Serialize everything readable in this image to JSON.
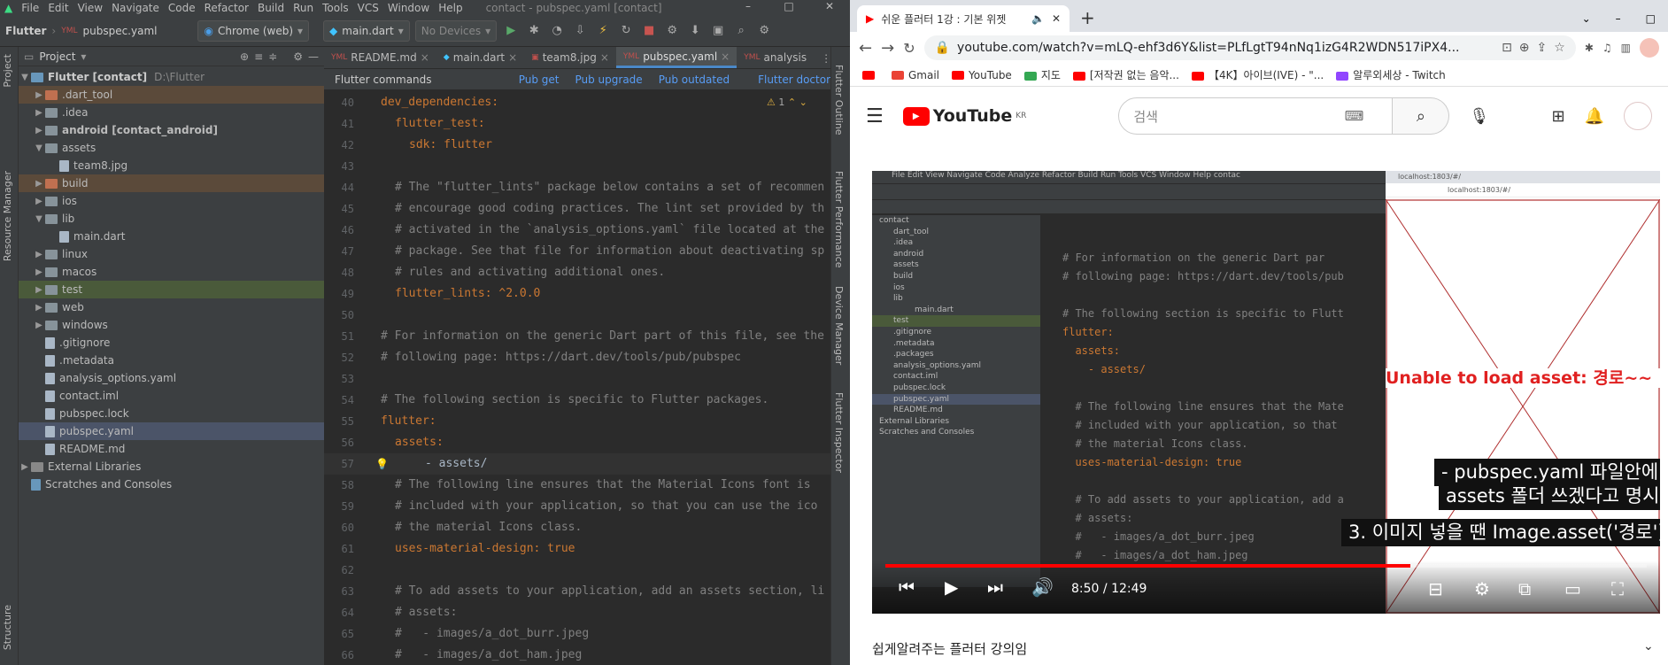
{
  "ide": {
    "menu": [
      "File",
      "Edit",
      "View",
      "Navigate",
      "Code",
      "Refactor",
      "Build",
      "Run",
      "Tools",
      "VCS",
      "Window",
      "Help"
    ],
    "window_title": "contact - pubspec.yaml [contact]",
    "breadcrumb_project": "Flutter",
    "breadcrumb_file": "pubspec.yaml",
    "device_selector": "Chrome (web)",
    "run_config": "main.dart",
    "no_devices": "No Devices",
    "project_label": "Project",
    "tree_root_name": "Flutter [contact]",
    "tree_root_path": "D:\\Flutter",
    "tree": [
      {
        "name": ".dart_tool",
        "type": "folder",
        "depth": 1,
        "arrow": "right"
      },
      {
        "name": ".idea",
        "type": "folder",
        "depth": 1,
        "arrow": "right"
      },
      {
        "name": "android [contact_android]",
        "type": "folder",
        "depth": 1,
        "arrow": "right"
      },
      {
        "name": "assets",
        "type": "folder",
        "depth": 1,
        "arrow": "down"
      },
      {
        "name": "team8.jpg",
        "type": "file",
        "depth": 2,
        "arrow": ""
      },
      {
        "name": "build",
        "type": "folder",
        "depth": 1,
        "arrow": "right"
      },
      {
        "name": "ios",
        "type": "folder",
        "depth": 1,
        "arrow": "right"
      },
      {
        "name": "lib",
        "type": "folder",
        "depth": 1,
        "arrow": "down"
      },
      {
        "name": "main.dart",
        "type": "file",
        "depth": 2,
        "arrow": ""
      },
      {
        "name": "linux",
        "type": "folder",
        "depth": 1,
        "arrow": "right"
      },
      {
        "name": "macos",
        "type": "folder",
        "depth": 1,
        "arrow": "right"
      },
      {
        "name": "test",
        "type": "folder",
        "depth": 1,
        "arrow": "right"
      },
      {
        "name": "web",
        "type": "folder",
        "depth": 1,
        "arrow": "right"
      },
      {
        "name": "windows",
        "type": "folder",
        "depth": 1,
        "arrow": "right"
      },
      {
        "name": ".gitignore",
        "type": "file",
        "depth": 1,
        "arrow": ""
      },
      {
        "name": ".metadata",
        "type": "file",
        "depth": 1,
        "arrow": ""
      },
      {
        "name": "analysis_options.yaml",
        "type": "file",
        "depth": 1,
        "arrow": ""
      },
      {
        "name": "contact.iml",
        "type": "file",
        "depth": 1,
        "arrow": ""
      },
      {
        "name": "pubspec.lock",
        "type": "file",
        "depth": 1,
        "arrow": ""
      },
      {
        "name": "pubspec.yaml",
        "type": "file",
        "depth": 1,
        "arrow": ""
      },
      {
        "name": "README.md",
        "type": "file",
        "depth": 1,
        "arrow": ""
      },
      {
        "name": "External Libraries",
        "type": "lib",
        "depth": 0,
        "arrow": "right"
      },
      {
        "name": "Scratches and Consoles",
        "type": "scratch",
        "depth": 0,
        "arrow": ""
      }
    ],
    "tabs": [
      "README.md",
      "main.dart",
      "team8.jpg",
      "pubspec.yaml",
      "analysis"
    ],
    "active_tab": "pubspec.yaml",
    "flutter_commands": {
      "label": "Flutter commands",
      "pub_get": "Pub get",
      "pub_upgrade": "Pub upgrade",
      "pub_outdated": "Pub outdated",
      "flutter_doctor": "Flutter doctor"
    },
    "warning_count": "1",
    "code_lines": [
      {
        "n": "40",
        "text": "dev_dependencies:",
        "kind": "key",
        "indent": 0
      },
      {
        "n": "41",
        "text": "flutter_test:",
        "kind": "key",
        "indent": 1
      },
      {
        "n": "42",
        "text": "sdk: flutter",
        "kind": "kv",
        "indent": 2
      },
      {
        "n": "43",
        "text": "",
        "kind": "blank",
        "indent": 0
      },
      {
        "n": "44",
        "text": "# The \"flutter_lints\" package below contains a set of recommen",
        "kind": "cmt",
        "indent": 1
      },
      {
        "n": "45",
        "text": "# encourage good coding practices. The lint set provided by th",
        "kind": "cmt",
        "indent": 1
      },
      {
        "n": "46",
        "text": "# activated in the `analysis_options.yaml` file located at the",
        "kind": "cmt",
        "indent": 1
      },
      {
        "n": "47",
        "text": "# package. See that file for information about deactivating sp",
        "kind": "cmt",
        "indent": 1
      },
      {
        "n": "48",
        "text": "# rules and activating additional ones.",
        "kind": "cmt",
        "indent": 1
      },
      {
        "n": "49",
        "text": "flutter_lints: ^2.0.0",
        "kind": "kv",
        "indent": 1
      },
      {
        "n": "50",
        "text": "",
        "kind": "blank",
        "indent": 0
      },
      {
        "n": "51",
        "text": "# For information on the generic Dart part of this file, see the",
        "kind": "cmt",
        "indent": 0
      },
      {
        "n": "52",
        "text": "# following page: https://dart.dev/tools/pub/pubspec",
        "kind": "cmt",
        "indent": 0
      },
      {
        "n": "53",
        "text": "",
        "kind": "blank",
        "indent": 0
      },
      {
        "n": "54",
        "text": "# The following section is specific to Flutter packages.",
        "kind": "cmt",
        "indent": 0
      },
      {
        "n": "55",
        "text": "flutter:",
        "kind": "key",
        "indent": 0
      },
      {
        "n": "56",
        "text": "assets:",
        "kind": "key",
        "indent": 1
      },
      {
        "n": "57",
        "text": "- assets/",
        "kind": "val",
        "indent": 2
      },
      {
        "n": "58",
        "text": "# The following line ensures that the Material Icons font is",
        "kind": "cmt",
        "indent": 1
      },
      {
        "n": "59",
        "text": "# included with your application, so that you can use the ico",
        "kind": "cmt",
        "indent": 1
      },
      {
        "n": "60",
        "text": "# the material Icons class.",
        "kind": "cmt",
        "indent": 1
      },
      {
        "n": "61",
        "text": "uses-material-design: true",
        "kind": "kv",
        "indent": 1
      },
      {
        "n": "62",
        "text": "",
        "kind": "blank",
        "indent": 0
      },
      {
        "n": "63",
        "text": "# To add assets to your application, add an assets section, li",
        "kind": "cmt",
        "indent": 1
      },
      {
        "n": "64",
        "text": "# assets:",
        "kind": "cmt",
        "indent": 1
      },
      {
        "n": "65",
        "text": "#   - images/a_dot_burr.jpeg",
        "kind": "cmt",
        "indent": 1
      },
      {
        "n": "66",
        "text": "#   - images/a_dot_ham.jpeg",
        "kind": "cmt",
        "indent": 1
      }
    ],
    "right_tools": [
      "Flutter Outline",
      "Flutter Performance",
      "Device Manager",
      "Flutter Inspector"
    ],
    "left_tools": [
      "Project",
      "Resource Manager",
      "Structure"
    ]
  },
  "browser": {
    "tab_title": "쉬운 플러터 1강 : 기본 위젯",
    "url": "youtube.com/watch?v=mLQ-ehf3d6Y&list=PLfLgtT94nNq1izG4R2WDN517iPX4...",
    "bookmarks": [
      {
        "label": "",
        "color": "#ff0000"
      },
      {
        "label": "Gmail",
        "color": "#ea4335"
      },
      {
        "label": "YouTube",
        "color": "#ff0000"
      },
      {
        "label": "지도",
        "color": "#34a853"
      },
      {
        "label": "[저작권 없는 음악...",
        "color": "#ff0000"
      },
      {
        "label": "【4K】아이브(IVE) - \"...",
        "color": "#ff0000"
      },
      {
        "label": "알루외세상 - Twitch",
        "color": "#9146ff"
      }
    ],
    "yt_logo": "YouTube",
    "yt_region": "KR",
    "search_placeholder": "검색",
    "video": {
      "time_current": "8:50",
      "time_total": "12:49",
      "progress": 0.69,
      "error_text": "Unable to load asset: 경로~~",
      "caption1": "- pubspec.yaml 파일안에",
      "caption2": "assets 폴더 쓰겠다고 명시",
      "caption3": "3. 이미지 넣을 땐 Image.asset('경로')",
      "inner_url": "localhost:1803/#/",
      "inner_tab": "localhost:1803/#/",
      "inner_tree": [
        "contact",
        "dart_tool",
        ".idea",
        "android",
        "assets",
        "build",
        "ios",
        "lib",
        "main.dart",
        "test",
        ".gitignore",
        ".metadata",
        ".packages",
        "analysis_options.yaml",
        "contact.iml",
        "pubspec.lock",
        "pubspec.yaml",
        "README.md",
        "External Libraries",
        "Scratches and Consoles"
      ],
      "inner_code": [
        "# For information on the generic Dart par",
        "# following page: https://dart.dev/tools/pub",
        "",
        "# The following section is specific to Flutt",
        "flutter:",
        "  assets:",
        "    - assets/",
        "",
        "  # The following line ensures that the Mate",
        "  # included with your application, so that",
        "  # the material Icons class.",
        "  uses-material-design: true",
        "",
        "  # To add assets to your application, add a",
        "  # assets:",
        "  #   - images/a_dot_burr.jpeg",
        "  #   - images/a_dot_ham.jpeg"
      ]
    },
    "below_title": "쉽게알려주는 플러터 강의임"
  }
}
